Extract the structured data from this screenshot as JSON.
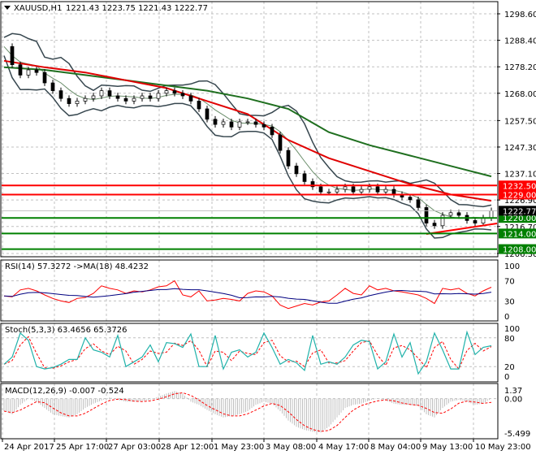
{
  "header": {
    "symbol": "XAUUSD,H1",
    "ohlc": "1221.43 1223.75 1221.43 1222.77"
  },
  "colors": {
    "bg": "#ffffff",
    "grid": "#c0c0c0",
    "resistance": "#ff0000",
    "support": "#008000",
    "price_tag": "#000000",
    "ma_slow": "#1f6f1f",
    "ma_fast": "#e00000",
    "bands": "#37474f",
    "rsi": "#ff0000",
    "rsi_ma": "#000080",
    "stoch_main": "#20b2aa",
    "stoch_signal": "#ff0000",
    "macd_hist": "#c0c0c0",
    "macd_signal": "#ff0000"
  },
  "chart_data": [
    {
      "type": "line",
      "title": "XAUUSD,H1",
      "ylim": [
        1206.3,
        1298.6
      ],
      "y_ticks": [
        "1298.60",
        "1288.40",
        "1278.20",
        "1268.00",
        "1257.50",
        "1247.30",
        "1237.10",
        "1226.90",
        "1216.70",
        "1206.30"
      ],
      "x_ticks": [
        "24 Apr 2017",
        "25 Apr 17:00",
        "27 Apr 03:00",
        "28 Apr 12:00",
        "1 May 23:00",
        "3 May 08:00",
        "4 May 17:00",
        "8 May 04:00",
        "9 May 13:00",
        "10 May 23:00"
      ],
      "close": [
        1286,
        1279,
        1275,
        1277,
        1276,
        1272,
        1269,
        1266,
        1264,
        1265,
        1266,
        1267,
        1269,
        1267,
        1266,
        1265,
        1266,
        1267,
        1266,
        1268,
        1269,
        1268,
        1267,
        1265,
        1262,
        1258,
        1256,
        1257,
        1255,
        1257,
        1257,
        1256,
        1255,
        1252,
        1246,
        1240,
        1237,
        1234,
        1232,
        1230,
        1230,
        1231,
        1232,
        1230,
        1231,
        1232,
        1230,
        1231,
        1229,
        1228,
        1227,
        1224,
        1218,
        1217,
        1221,
        1222,
        1221,
        1219,
        1218,
        1220,
        1222.77
      ],
      "ma_slow": [
        1278,
        1277,
        1275,
        1273,
        1271,
        1269,
        1266,
        1262,
        1253,
        1248,
        1244,
        1240,
        1236
      ],
      "ma_fast": [
        1280.5,
        1278,
        1276,
        1273,
        1270,
        1265,
        1260,
        1250,
        1243,
        1238,
        1233,
        1229,
        1226.6
      ],
      "levels": [
        {
          "label": "1232.50",
          "value": 1232.5,
          "kind": "resistance"
        },
        {
          "label": "1229.00",
          "value": 1229.0,
          "kind": "resistance"
        },
        {
          "label": "1220.00",
          "value": 1220.0,
          "kind": "support"
        },
        {
          "label": "1214.00",
          "value": 1214.0,
          "kind": "support"
        },
        {
          "label": "1208.00",
          "value": 1208.0,
          "kind": "support"
        }
      ],
      "last_price": "1222.77"
    },
    {
      "type": "line",
      "title": "RSI(14) 57.3272  ->MA(18) 48.4232",
      "ylim": [
        0,
        100
      ],
      "y_ticks": [
        "100",
        "70",
        "30",
        "0"
      ],
      "rsi": [
        40,
        38,
        52,
        55,
        50,
        42,
        35,
        30,
        27,
        35,
        37,
        45,
        60,
        55,
        52,
        45,
        50,
        48,
        52,
        58,
        60,
        70,
        42,
        38,
        50,
        30,
        32,
        35,
        33,
        30,
        45,
        50,
        48,
        40,
        22,
        15,
        20,
        25,
        22,
        28,
        30,
        42,
        55,
        45,
        42,
        60,
        52,
        55,
        50,
        48,
        45,
        42,
        35,
        25,
        55,
        52,
        55,
        45,
        40,
        50,
        57.3
      ]
    },
    {
      "type": "line",
      "title": "Stoch(5,3,3) 63.4656 65.3726",
      "ylim": [
        0,
        100
      ],
      "y_ticks": [
        "100",
        "80",
        "20",
        "0"
      ],
      "main": [
        25,
        40,
        90,
        75,
        20,
        15,
        18,
        25,
        35,
        35,
        80,
        55,
        50,
        40,
        85,
        20,
        30,
        40,
        65,
        30,
        70,
        68,
        60,
        88,
        20,
        20,
        85,
        15,
        50,
        55,
        40,
        50,
        90,
        60,
        25,
        35,
        28,
        12,
        85,
        25,
        30,
        25,
        40,
        65,
        75,
        72,
        15,
        30,
        88,
        40,
        70,
        5,
        30,
        90,
        55,
        15,
        15,
        92,
        45,
        60,
        63.5
      ]
    },
    {
      "type": "bar",
      "title": "MACD(12,26,9) -0.007 -0.524",
      "ylim": [
        -5.499,
        1.37
      ],
      "y_ticks": [
        "1.37",
        "0.00",
        "-5.499"
      ],
      "hist": [
        -2,
        -2.5,
        -1,
        0,
        -0.5,
        -1.5,
        -2.5,
        -2.8,
        -3,
        -2.5,
        -1.5,
        -0.8,
        -0.3,
        0.2,
        -0.2,
        -0.5,
        -0.5,
        -0.4,
        -0.2,
        0.3,
        0.8,
        1.2,
        0.8,
        -0.5,
        -1,
        -1.8,
        -2.5,
        -3,
        -2.8,
        -2.5,
        -2,
        -1,
        -0.5,
        -0.8,
        -2,
        -3.5,
        -4.5,
        -5,
        -5.3,
        -5.4,
        -4.5,
        -3,
        -1.5,
        -1,
        -0.8,
        -0.3,
        0,
        -0.3,
        -0.8,
        -1,
        -1,
        -1.2,
        -2.5,
        -3,
        -1.5,
        -0.5,
        -0.2,
        -0.5,
        -1,
        -0.8,
        -0.007
      ]
    }
  ]
}
